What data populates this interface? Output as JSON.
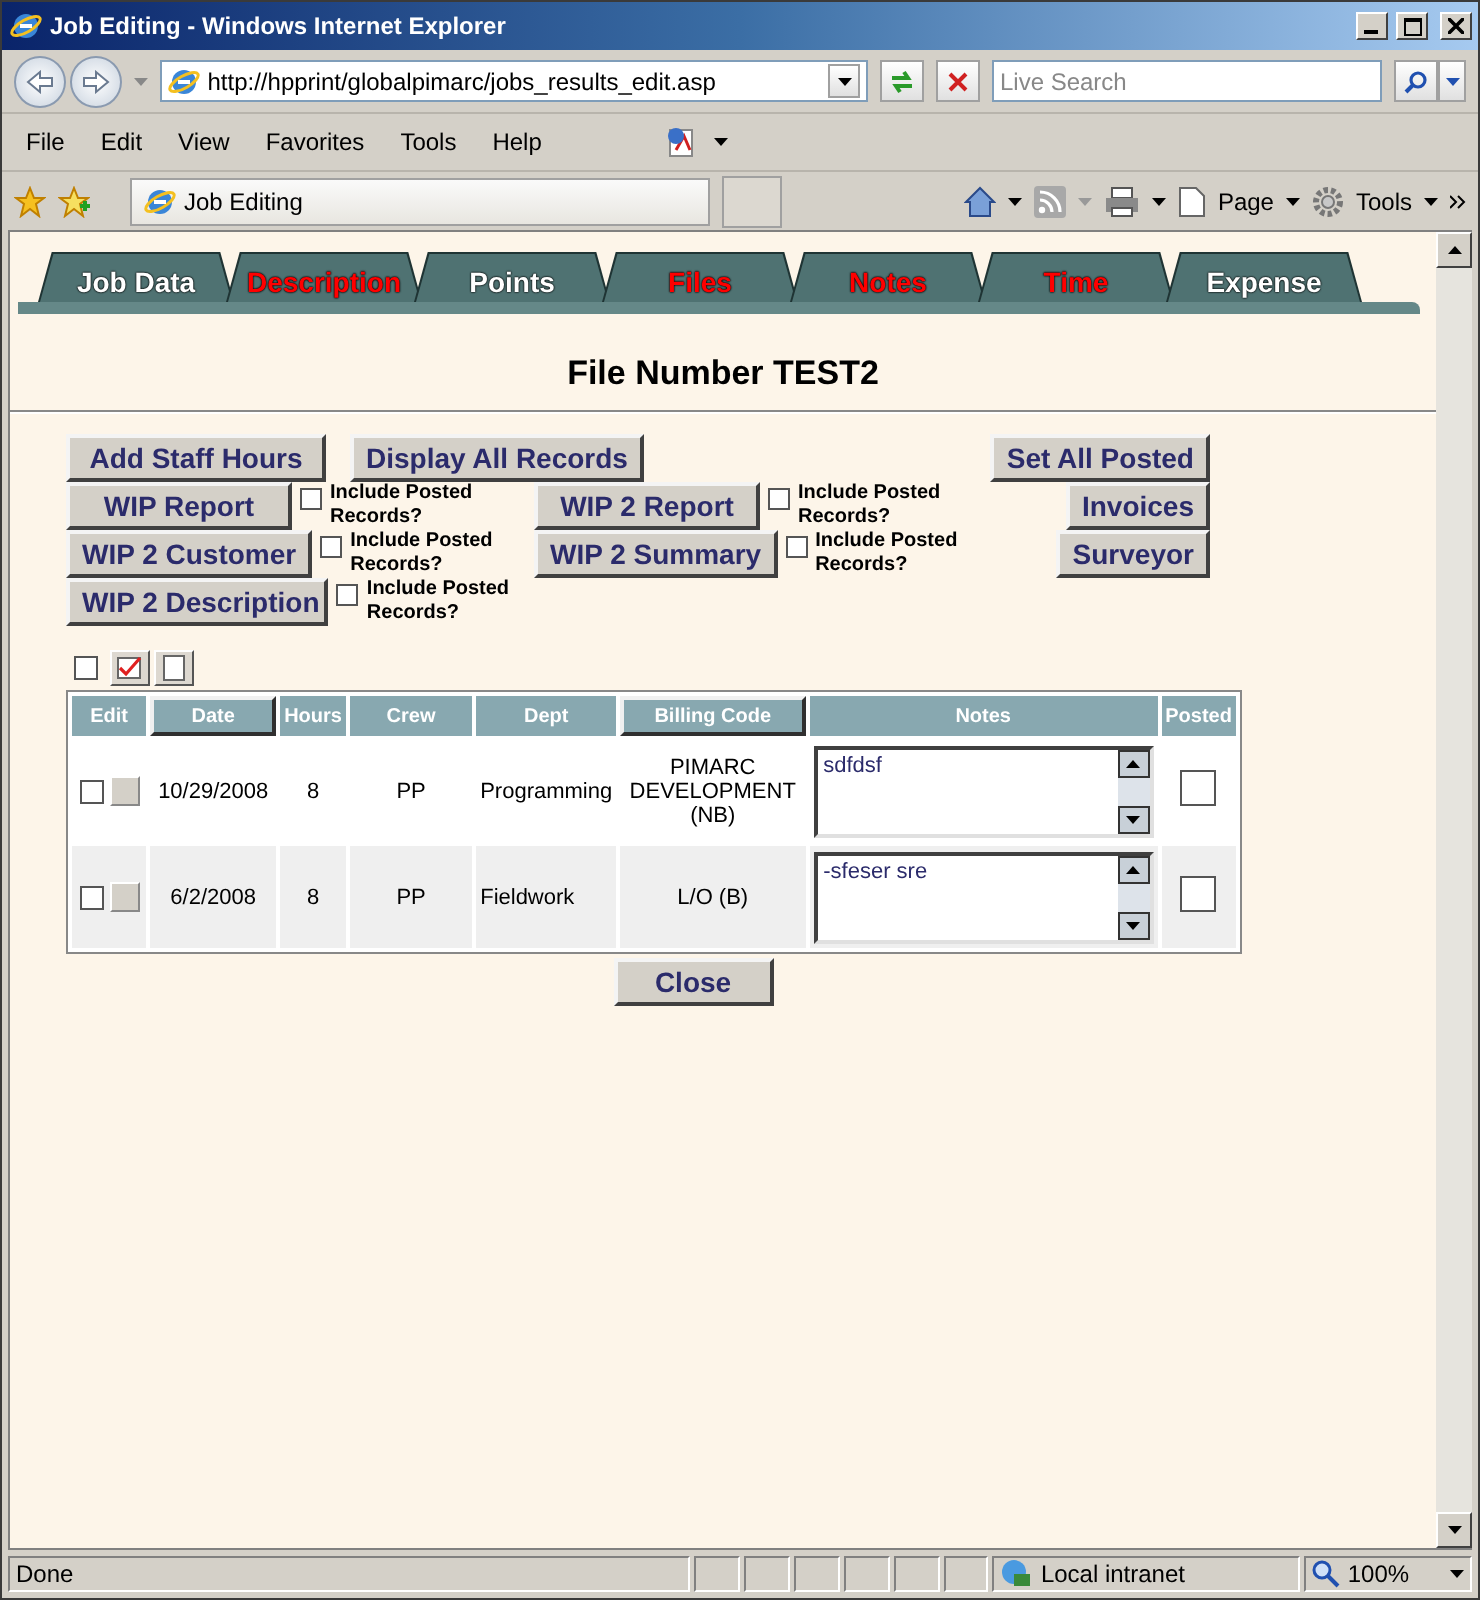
{
  "window": {
    "title": "Job Editing - Windows Internet Explorer"
  },
  "address_bar": {
    "url": "http://hpprint/globalpimarc/jobs_results_edit.asp",
    "search_placeholder": "Live Search"
  },
  "menu": [
    "File",
    "Edit",
    "View",
    "Favorites",
    "Tools",
    "Help"
  ],
  "browser_tab": {
    "title": "Job Editing"
  },
  "command_bar": [
    "Page",
    "Tools"
  ],
  "tabs": [
    {
      "label": "Job Data",
      "color": "#ffffff"
    },
    {
      "label": "Description",
      "color": "#ff0000"
    },
    {
      "label": "Points",
      "color": "#ffffff"
    },
    {
      "label": "Files",
      "color": "#ff0000"
    },
    {
      "label": "Notes",
      "color": "#ff0000"
    },
    {
      "label": "Time",
      "color": "#ff0000"
    },
    {
      "label": "Expense",
      "color": "#ffffff"
    }
  ],
  "heading": "File Number TEST2",
  "action_rows": [
    {
      "items": [
        {
          "kind": "button",
          "label": "Add Staff Hours"
        },
        {
          "kind": "button",
          "label": "Display All Records"
        }
      ],
      "side": "Set All Posted"
    },
    {
      "items": [
        {
          "kind": "report",
          "label": "WIP Report",
          "option": "Include Posted Records?",
          "checked": false
        },
        {
          "kind": "report",
          "label": "WIP 2 Report",
          "option": "Include Posted Records?",
          "checked": false
        }
      ],
      "side": "Invoices"
    },
    {
      "items": [
        {
          "kind": "report",
          "label": "WIP 2 Customer",
          "option": "Include Posted Records?",
          "checked": false
        },
        {
          "kind": "report",
          "label": "WIP 2 Summary",
          "option": "Include Posted Records?",
          "checked": false
        }
      ],
      "side": "Surveyor"
    },
    {
      "items": [
        {
          "kind": "report",
          "label": "WIP 2 Description",
          "option": "Include Posted Records?",
          "checked": false
        }
      ]
    }
  ],
  "select_all": {
    "checked": false
  },
  "table": {
    "columns": [
      {
        "label": "Edit",
        "sortable": false
      },
      {
        "label": "Date",
        "sortable": true
      },
      {
        "label": "Hours",
        "sortable": false
      },
      {
        "label": "Crew",
        "sortable": false
      },
      {
        "label": "Dept",
        "sortable": false
      },
      {
        "label": "Billing Code",
        "sortable": true
      },
      {
        "label": "Notes",
        "sortable": false
      },
      {
        "label": "Posted",
        "sortable": false
      }
    ],
    "rows": [
      {
        "checked": false,
        "date": "10/29/2008",
        "hours": "8",
        "crew": "PP",
        "dept": "Programming",
        "billing_code": "PIMARC DEVELOPMENT (NB)",
        "notes": "sdfdsf",
        "posted": false
      },
      {
        "checked": false,
        "date": "6/2/2008",
        "hours": "8",
        "crew": "PP",
        "dept": "Fieldwork",
        "billing_code": "L/O (B)",
        "notes": "-sfeser sre",
        "posted": false
      }
    ]
  },
  "close_button": "Close",
  "status_bar": {
    "text": "Done",
    "zone": "Local intranet",
    "zoom": "100%"
  }
}
